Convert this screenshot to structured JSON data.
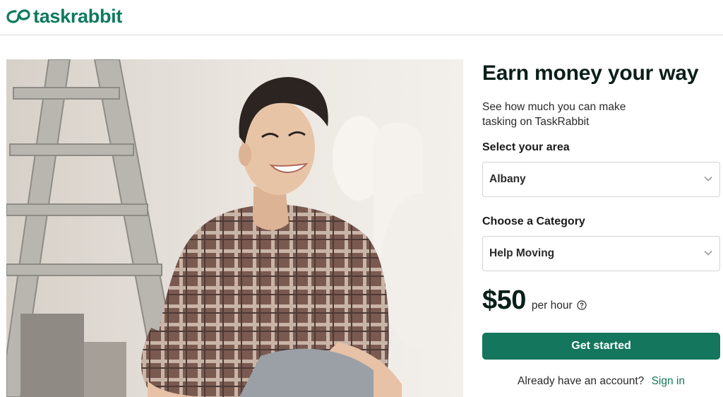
{
  "brand": {
    "name": "taskrabbit",
    "color": "#0d7a5f",
    "icon": "rabbit-logo-icon"
  },
  "hero": {
    "image": "smiling-tasker-photo"
  },
  "panel": {
    "headline": "Earn money your way",
    "subtext": "See how much you can make tasking on TaskRabbit",
    "area_label": "Select your area",
    "area_value": "Albany",
    "category_label": "Choose a Category",
    "category_value": "Help Moving",
    "price": "$50",
    "price_unit": "per hour",
    "cta_label": "Get started",
    "account_prompt": "Already have an account?",
    "signin_label": "Sign in"
  },
  "colors": {
    "accent": "#14765c",
    "heading": "#0b1f1a"
  }
}
